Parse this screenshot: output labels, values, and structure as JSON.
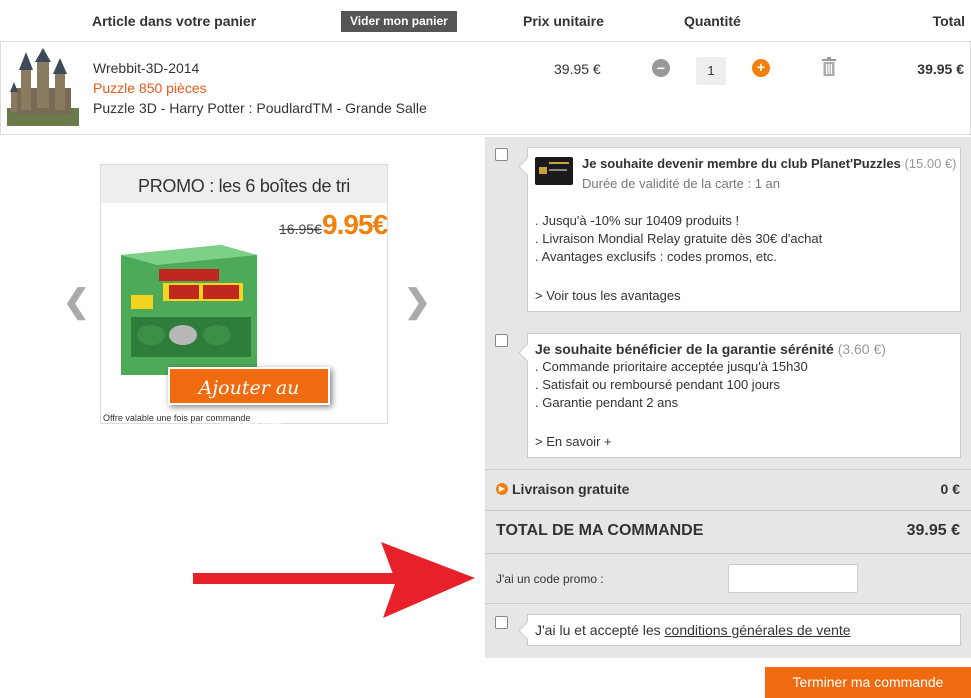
{
  "cart": {
    "headers": {
      "article": "Article dans votre panier",
      "empty_btn": "Vider mon panier",
      "unit_price": "Prix unitaire",
      "quantity": "Quantité",
      "total": "Total"
    },
    "item": {
      "ref": "Wrebbit-3D-2014",
      "size": "Puzzle 850 pièces",
      "name": "Puzzle 3D - Harry Potter : PoudlardTM - Grande Salle",
      "unit_price": "39.95 €",
      "quantity": "1",
      "minus": "−",
      "plus": "+",
      "line_total": "39.95 €"
    }
  },
  "promo": {
    "title": "PROMO : les 6 boîtes de tri",
    "old_price": "16.95€",
    "new_price": "9.95€",
    "add_label": "Ajouter au panier",
    "note": "Offre valable une fois par commande",
    "prev": "❮",
    "next": "❯"
  },
  "options": {
    "club": {
      "title": "Je souhaite devenir membre du club Planet'Puzzles",
      "price": "(15.00 €)",
      "validity": "Durée de validité de la carte : 1 an",
      "lines": [
        ". Jusqu'à -10% sur 10409 produits !",
        ". Livraison Mondial Relay gratuite dès 30€ d'achat",
        ". Avantages exclusifs : codes promos, etc."
      ],
      "link": "> Voir tous les avantages"
    },
    "garantie": {
      "title": "Je souhaite bénéficier de la garantie sérénité",
      "price": "(3.60 €)",
      "lines": [
        ". Commande prioritaire acceptée jusqu'à 15h30",
        ". Satisfait ou remboursé pendant 100 jours",
        ". Garantie pendant 2 ans"
      ],
      "link": "> En savoir +"
    }
  },
  "summary": {
    "livraison_label": "Livraison gratuite",
    "livraison_value": "0 €",
    "total_label": "TOTAL DE MA COMMANDE",
    "total_value": "39.95 €",
    "promo_label": "J'ai un code promo :",
    "promo_placeholder": "",
    "cgv_prefix": "J'ai lu et accepté les ",
    "cgv_link": "conditions générales de vente"
  },
  "checkout_label": "Terminer ma commande",
  "colors": {
    "accent": "#f06a0f",
    "arrow": "#e8202a"
  }
}
